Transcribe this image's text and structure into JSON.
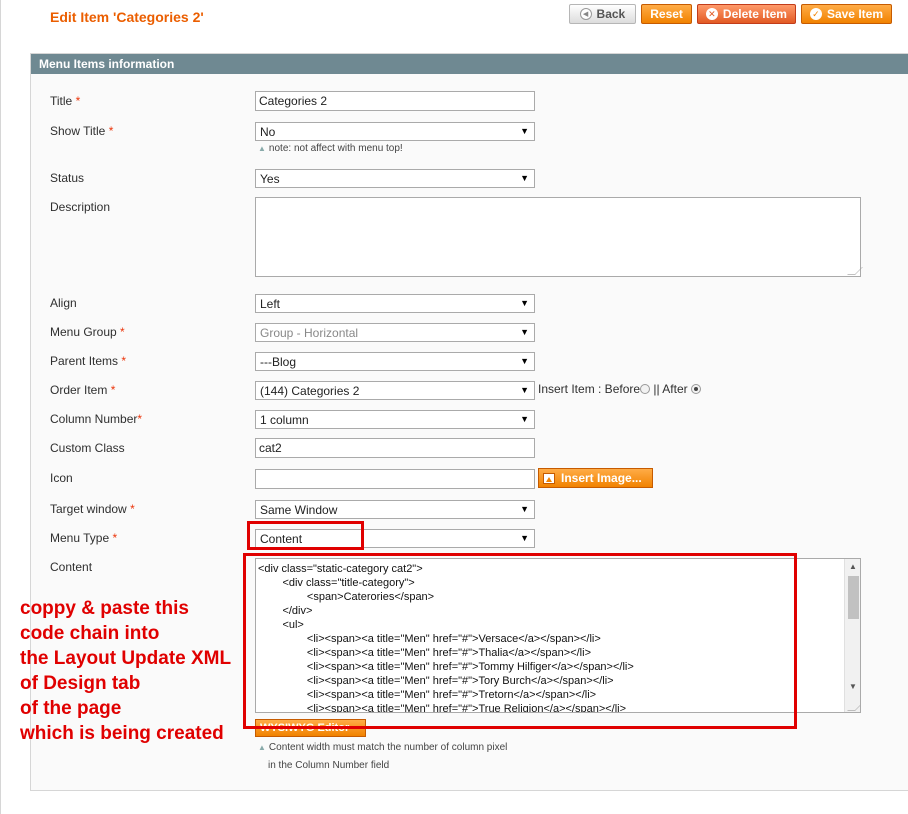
{
  "header": {
    "title": "Edit Item 'Categories 2'",
    "buttons": {
      "back": "Back",
      "reset": "Reset",
      "delete": "Delete Item",
      "save": "Save Item"
    }
  },
  "panel": {
    "title": "Menu Items information"
  },
  "form": {
    "title": {
      "label": "Title",
      "value": "Categories 2"
    },
    "show_title": {
      "label": "Show Title",
      "value": "No",
      "note": "note: not affect with menu top!"
    },
    "status": {
      "label": "Status",
      "value": "Yes"
    },
    "description": {
      "label": "Description",
      "value": ""
    },
    "align": {
      "label": "Align",
      "value": "Left"
    },
    "menu_group": {
      "label": "Menu Group",
      "value": "Group - Horizontal"
    },
    "parent_items": {
      "label": "Parent Items",
      "value": "---Blog"
    },
    "order_item": {
      "label": "Order Item",
      "value": "(144) Categories 2",
      "insert_label": "Insert Item : Before",
      "separator": "||",
      "after_label": "After"
    },
    "column_number": {
      "label": "Column Number",
      "value": "1 column"
    },
    "custom_class": {
      "label": "Custom Class",
      "value": "cat2"
    },
    "icon": {
      "label": "Icon",
      "value": "",
      "button": "Insert Image..."
    },
    "target_window": {
      "label": "Target window",
      "value": "Same Window"
    },
    "menu_type": {
      "label": "Menu Type",
      "value": "Content"
    },
    "content": {
      "label": "Content",
      "code_lines": [
        "<div class=\"static-category cat2\">",
        "        <div class=\"title-category\">",
        "                <span>Caterories</span>",
        "        </div>",
        "        <ul>",
        "                <li><span><a title=\"Men\" href=\"#\">Versace</a></span></li>",
        "                <li><span><a title=\"Men\" href=\"#\">Thalia</a></span></li>",
        "                <li><span><a title=\"Men\" href=\"#\">Tommy Hilfiger</a></span></li>",
        "                <li><span><a title=\"Men\" href=\"#\">Tory Burch</a></span></li>",
        "                <li><span><a title=\"Men\" href=\"#\">Tretorn</a></span></li>",
        "                <li><span><a title=\"Men\" href=\"#\">True Religion</a></span></li>"
      ],
      "wysiwyg_button": "WYSIWYG Editor",
      "note_line1": "Content width must match the number of column pixel",
      "note_line2": "in the Column Number field"
    }
  },
  "annotation": {
    "lines": [
      "coppy & paste this",
      "code chain into",
      "the Layout Update XML",
      "of Design tab",
      "of the page",
      "which is being created"
    ],
    "color": "#e00000"
  },
  "required_mark": "*",
  "icons": {
    "back": "back-arrow-icon",
    "delete": "delete-x-icon",
    "save": "checkmark-icon",
    "insert_image": "image-icon"
  }
}
